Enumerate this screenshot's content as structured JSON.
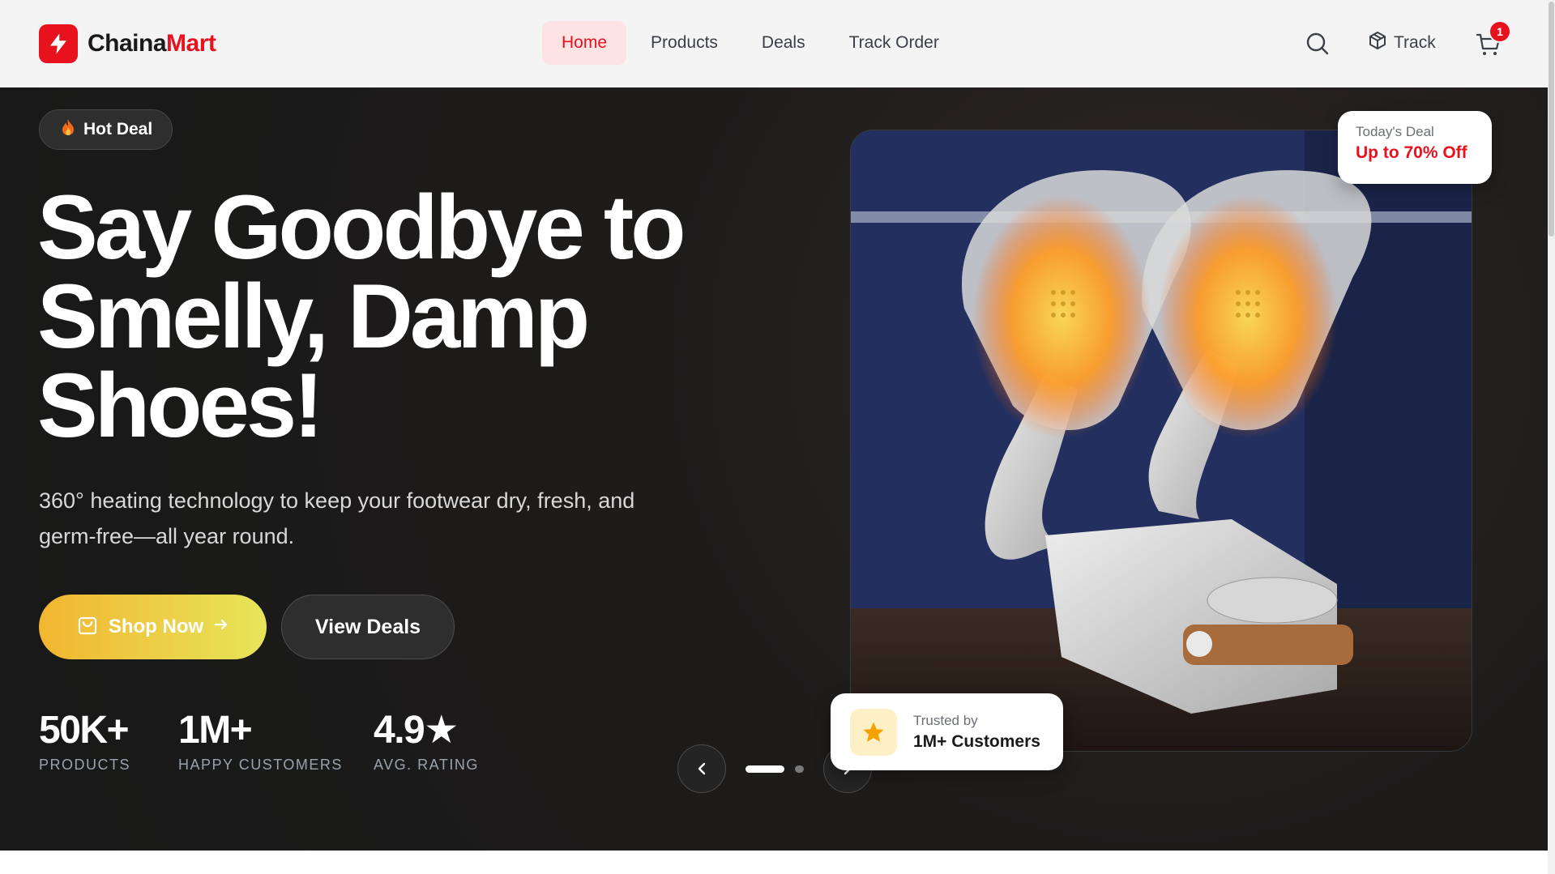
{
  "header": {
    "logo_text_1": "Chaina",
    "logo_text_2": "Mart",
    "nav": [
      {
        "label": "Home",
        "active": true
      },
      {
        "label": "Products",
        "active": false
      },
      {
        "label": "Deals",
        "active": false
      },
      {
        "label": "Track Order",
        "active": false
      }
    ],
    "track_label": "Track",
    "cart_count": "1",
    "icons": [
      "bolt-icon",
      "search-icon",
      "package-icon",
      "cart-icon"
    ]
  },
  "hero": {
    "badge": "Hot Deal",
    "headline_lines": [
      "Say Goodbye to",
      "Smelly, Damp",
      "Shoes!"
    ],
    "subtext": "360° heating technology to keep your footwear dry, fresh, and germ-free—all year round.",
    "shop_button": "Shop Now",
    "deals_button": "View Deals",
    "stats": [
      {
        "value": "50K+",
        "label": "PRODUCTS"
      },
      {
        "value": "1M+",
        "label": "HAPPY CUSTOMERS"
      },
      {
        "value": "4.9★",
        "label": "AVG. RATING"
      }
    ],
    "carousel": {
      "slides": 2,
      "active": 1
    },
    "deal_card": {
      "label": "Today's Deal",
      "value": "Up to 70% Off"
    },
    "trust_card": {
      "label": "Trusted by",
      "value": "1M+ Customers"
    }
  },
  "colors": {
    "brand": "#e8121f",
    "hero_bg": "#1e1c1b",
    "shop_gradient_start": "#f2b630",
    "shop_gradient_end": "#e7e55a"
  }
}
